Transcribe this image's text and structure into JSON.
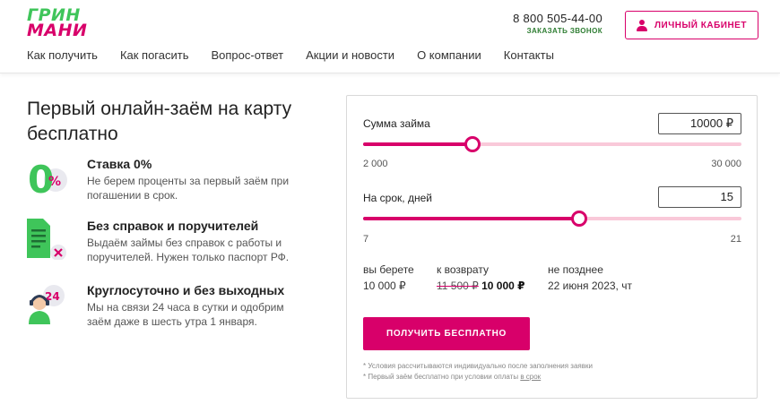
{
  "brand": {
    "line1": "ГРИН",
    "line2": "МАНИ"
  },
  "header": {
    "phone": "8 800 505-44-00",
    "callback": "ЗАКАЗАТЬ ЗВОНОК",
    "cabinet": "ЛИЧНЫЙ КАБИНЕТ"
  },
  "nav": [
    "Как получить",
    "Как погасить",
    "Вопрос-ответ",
    "Акции и новости",
    "О компании",
    "Контакты"
  ],
  "hero": {
    "title": "Первый онлайн-заём на карту бесплатно"
  },
  "features": [
    {
      "icon": "zero-percent-icon",
      "title": "Ставка 0%",
      "desc": "Не берем проценты за первый заём при погашении в срок."
    },
    {
      "icon": "document-icon",
      "title": "Без справок и поручителей",
      "desc": "Выдаём займы без справок с работы и поручителей. Нужен только паспорт РФ."
    },
    {
      "icon": "support-24-icon",
      "title": "Круглосуточно и без выходных",
      "desc": "Мы на связи 24 часа в сутки и одобрим заём даже в шесть утра 1 января."
    }
  ],
  "calculator": {
    "amount": {
      "label": "Сумма займа",
      "value": "10000 ₽",
      "min": "2 000",
      "max": "30 000",
      "level": 0.29
    },
    "term": {
      "label": "На срок, дней",
      "value": "15",
      "min": "7",
      "max": "21",
      "level": 0.57
    },
    "summary": {
      "take_label": "вы берете",
      "take_value": "10 000 ₽",
      "return_label": "к возврату",
      "return_old": "11 500 ₽",
      "return_new": "10 000 ₽",
      "due_label": "не позднее",
      "due_value": "22 июня 2023, чт"
    },
    "button": "ПОЛУЧИТЬ БЕСПЛАТНО",
    "note1": "* Условия рассчитываются индивидуально после заполнения заявки",
    "note2": "* Первый заём бесплатно при условии оплаты",
    "note2_link": "в срок"
  },
  "colors": {
    "brand_pink": "#d8006a",
    "brand_green": "#3fc55a",
    "track": "#f9c9d9"
  }
}
